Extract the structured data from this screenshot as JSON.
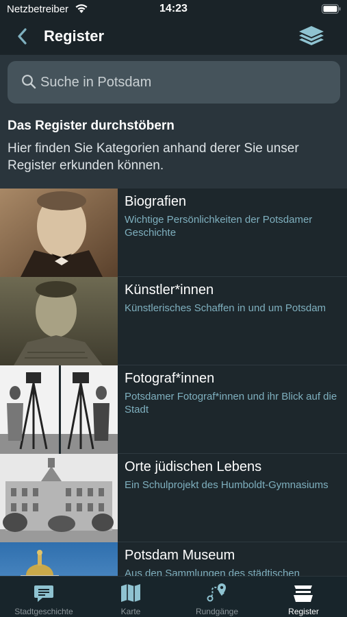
{
  "status": {
    "carrier": "Netzbetreiber",
    "time": "14:23"
  },
  "nav": {
    "title": "Register"
  },
  "search": {
    "placeholder": "Suche in Potsdam"
  },
  "intro": {
    "title": "Das Register durchstöbern",
    "text": "Hier finden Sie Kategorien anhand derer Sie unser Register erkunden können."
  },
  "categories": [
    {
      "title": "Biografien",
      "subtitle": "Wichtige Persönlichkeiten der Potsdamer Geschichte"
    },
    {
      "title": "Künstler*innen",
      "subtitle": "Künstlerisches Schaffen in und um Potsdam"
    },
    {
      "title": "Fotograf*innen",
      "subtitle": "Potsdamer Fotograf*innen und ihr Blick auf die Stadt"
    },
    {
      "title": "Orte jüdischen Lebens",
      "subtitle": "Ein Schulprojekt des Humboldt-Gymnasiums"
    },
    {
      "title": "Potsdam Museum",
      "subtitle": "Aus den Sammlungen des städtischen"
    }
  ],
  "tabs": [
    {
      "label": "Stadtgeschichte",
      "icon": "chat-icon"
    },
    {
      "label": "Karte",
      "icon": "map-icon"
    },
    {
      "label": "Rundgänge",
      "icon": "route-icon"
    },
    {
      "label": "Register",
      "icon": "register-icon",
      "active": true
    }
  ],
  "colors": {
    "accent": "#7fb0bf",
    "background": "#1f2a30",
    "search_field": "#45535b"
  }
}
